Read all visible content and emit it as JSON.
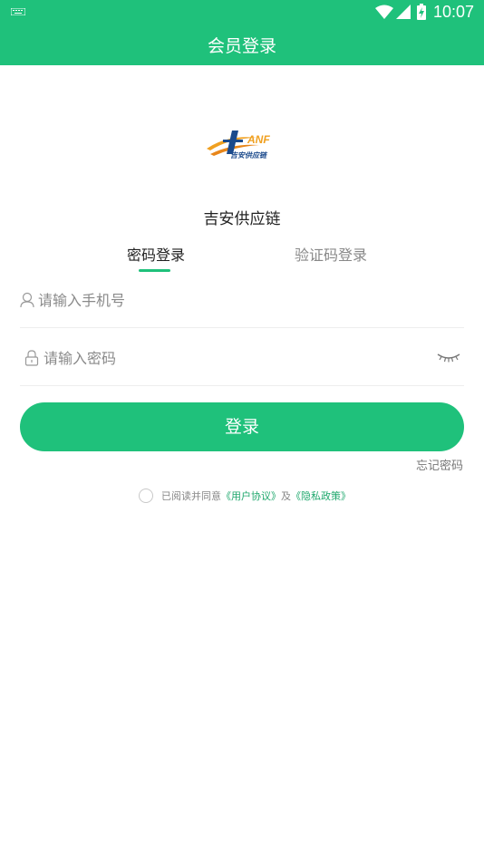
{
  "statusbar": {
    "time": "10:07"
  },
  "appbar": {
    "title": "会员登录"
  },
  "brand": {
    "name": "吉安供应链",
    "logo_text": "ANF",
    "logo_subtext": "吉安供应链"
  },
  "tabs": [
    {
      "label": "密码登录",
      "active": true
    },
    {
      "label": "验证码登录",
      "active": false
    }
  ],
  "form": {
    "phone_placeholder": "请输入手机号",
    "password_placeholder": "请输入密码",
    "login_label": "登录",
    "forgot_label": "忘记密码"
  },
  "agreement": {
    "prefix": "已阅读并同意",
    "user_agreement": "《用户协议》",
    "connector": "及",
    "privacy_policy": "《隐私政策》"
  },
  "colors": {
    "accent": "#1fc17b",
    "link": "#1fa86d"
  }
}
